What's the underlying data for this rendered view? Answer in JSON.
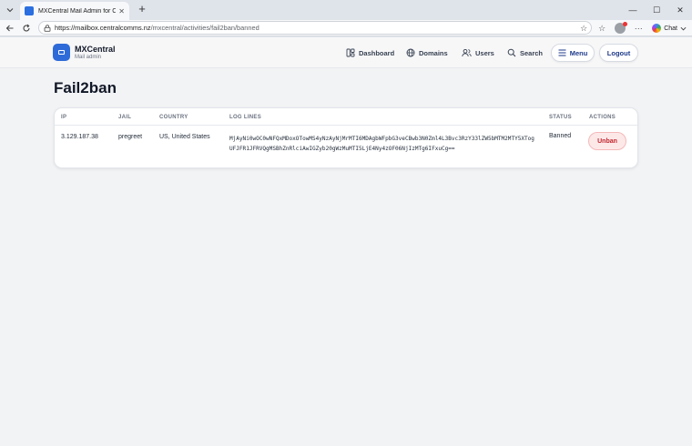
{
  "browser": {
    "tab_title": "MXCentral Mail Admin for CCL",
    "url_host": "https://mailbox.centralcomms.nz",
    "url_path": "/mxcentral/activities/fail2ban/banned",
    "chat_label": "Chat"
  },
  "header": {
    "brand_name": "MXCentral",
    "brand_sub": "Mail admin",
    "nav": [
      {
        "label": "Dashboard",
        "icon": "dashboard-icon"
      },
      {
        "label": "Domains",
        "icon": "globe-icon"
      },
      {
        "label": "Users",
        "icon": "users-icon"
      },
      {
        "label": "Search",
        "icon": "search-icon"
      }
    ],
    "menu_label": "Menu",
    "logout_label": "Logout"
  },
  "main": {
    "page_title": "Fail2ban",
    "table": {
      "columns": [
        "IP",
        "JAIL",
        "COUNTRY",
        "LOG LINES",
        "STATUS",
        "ACTIONS"
      ],
      "rows": [
        {
          "ip": "3.129.187.38",
          "jail": "pregreet",
          "country": "US, United States",
          "log_lines": "MjAyNi0wOC0wNFQxMDoxOTowMS4yNzAyNjMrMTI6MDAgbWFpbG3veCBwb3N0Zml4L3Bvc3RzY33lZW5bMTM2MTY5XTogUFJFR1JFRVQgMSBhZnRlciAwIGZyb20gWzMuMTI5LjE4Ny4zOF06NjIzMTg6IFxuCg==",
          "status": "Banned",
          "action_label": "Unban"
        }
      ]
    }
  }
}
